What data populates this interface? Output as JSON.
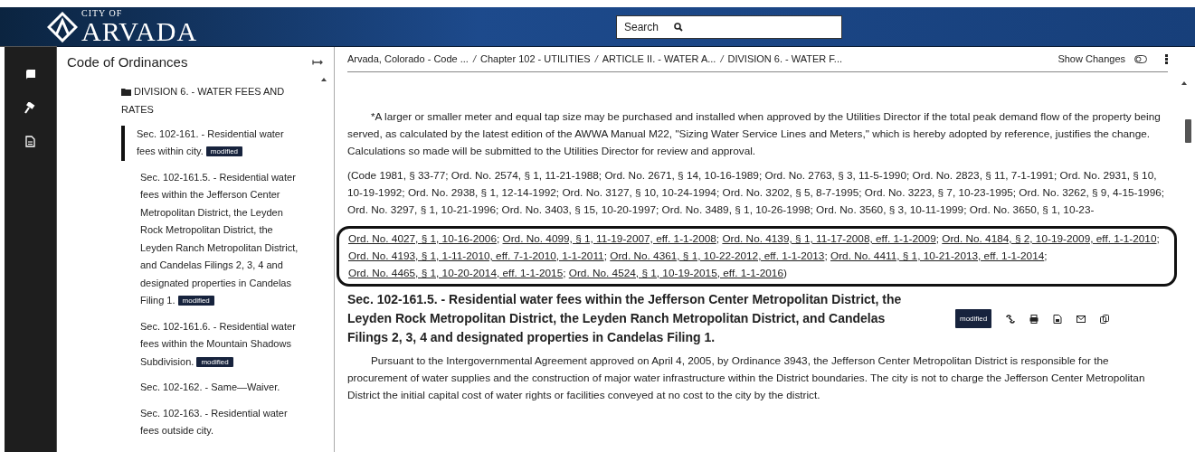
{
  "header": {
    "logo": {
      "kicker": "CITY OF",
      "name": "ARVADA"
    },
    "search": {
      "placeholder": "Search"
    }
  },
  "sidebar": {
    "title": "Code of Ordinances",
    "tree": {
      "label": "DIVISION 6. - WATER FEES AND RATES",
      "children": [
        {
          "label": "Sec. 102-161. - Residential water fees within city.",
          "badge": "modified",
          "selected": true
        },
        {
          "label": "Sec. 102-161.5. - Residential water fees within the Jefferson Center Metropolitan District, the Leyden Rock Metropolitan District, the Leyden Ranch Metropolitan District, and Candelas Filings 2, 3, 4 and designated properties in Candelas Filing 1.",
          "badge": "modified",
          "selected": false
        },
        {
          "label": "Sec. 102-161.6. - Residential water fees within the Mountain Shadows Subdivision.",
          "badge": "modified",
          "selected": false
        },
        {
          "label": "Sec. 102-162. - Same—Waiver.",
          "selected": false
        },
        {
          "label": "Sec. 102-163. - Residential water fees outside city.",
          "selected": false
        }
      ]
    }
  },
  "toolbar": {
    "breadcrumb_separator": "/",
    "breadcrumbs": [
      "Arvada, Colorado - Code ...",
      "Chapter 102 - UTILITIES",
      "ARTICLE II. - WATER A...",
      "DIVISION 6. - WATER F..."
    ],
    "show_changes": {
      "label": "Show Changes",
      "on": false
    }
  },
  "content": {
    "note": "*A larger or smaller meter and equal tap size may be purchased and installed when approved by the Utilities Director if the total peak demand flow of the property being served, as calculated by the latest edition of the AWWA Manual M22, \"Sizing Water Service Lines and Meters,\" which is hereby adopted by reference, justifies the change. Calculations so made will be submitted to the Utilities Director for review and approval.",
    "history": "(Code 1981, § 33-77; Ord. No. 2574, § 1, 11-21-1988; Ord. No. 2671, § 14, 10-16-1989; Ord. No. 2763, § 3, 11-5-1990; Ord. No. 2823, § 11, 7-1-1991; Ord. No. 2931, § 10, 10-19-1992; Ord. No. 2938, § 1, 12-14-1992; Ord. No. 3127, § 10, 10-24-1994; Ord. No. 3202, § 5, 8-7-1995; Ord. No. 3223, § 7, 10-23-1995; Ord. No. 3262, § 9, 4-15-1996; Ord. No. 3297, § 1, 10-21-1996; Ord. No. 3403, § 15, 10-20-1997; Ord. No. 3489, § 1, 10-26-1998; Ord. No. 3560, § 3, 10-11-1999; Ord. No. 3650, § 1, 10-23-",
    "history_links": [
      "Ord. No. 4027, § 1, 10-16-2006",
      "Ord. No. 4099, § 1, 11-19-2007, eff. 1-1-2008",
      "Ord. No. 4139, § 1, 11-17-2008, eff. 1-1-2009",
      "Ord. No. 4184, § 2, 10-19-2009, eff. 1-1-2010",
      "Ord. No. 4193, § 1, 1-11-2010, eff. 7-1-2010, 1-1-2011",
      "Ord. No. 4361, § 1, 10-22-2012, eff. 1-1-2013",
      "Ord. No. 4411, § 1, 10-21-2013, eff. 1-1-2014",
      "Ord. No. 4465, § 1, 10-20-2014, eff. 1-1-2015",
      "Ord. No. 4524, § 1, 10-19-2015, eff. 1-1-2016"
    ],
    "history_separator": ";",
    "history_end": ")",
    "section": {
      "title": "Sec. 102-161.5. - Residential water fees within the Jefferson Center Metropolitan District, the Leyden Rock Metropolitan District, the Leyden Ranch Metropolitan District, and Candelas Filings 2, 3, 4 and designated properties in Candelas Filing 1.",
      "badge": "modified",
      "body": "Pursuant to the Intergovernmental Agreement approved on April 4, 2005, by Ordinance 3943, the Jefferson Center Metropolitan District is responsible for the procurement of water supplies and the construction of major water infrastructure within the District boundaries. The city is not to charge the Jefferson Center Metropolitan District the initial capital cost of water rights or facilities conveyed at no cost to the city by the district."
    }
  }
}
